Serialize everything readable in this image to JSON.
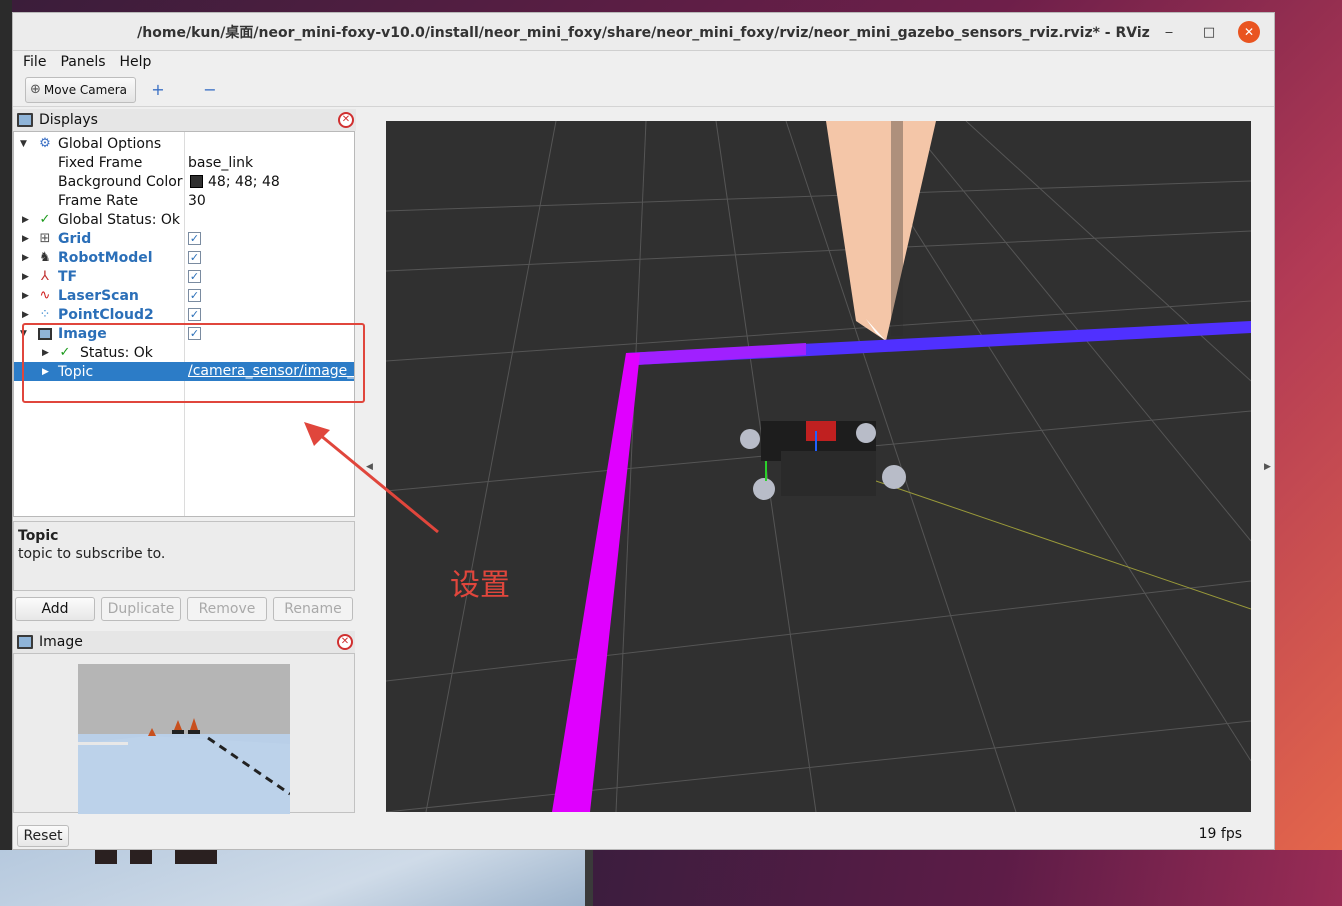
{
  "window": {
    "title": "/home/kun/桌面/neor_mini-foxy-v10.0/install/neor_mini_foxy/share/neor_mini_foxy/rviz/neor_mini_gazebo_sensors_rviz.rviz* - RViz",
    "minimize": "‒",
    "maximize": "□",
    "close": "✕"
  },
  "menu": {
    "file": "File",
    "panels": "Panels",
    "help": "Help"
  },
  "toolbar": {
    "move_camera": "Move Camera",
    "add": "+",
    "remove": "−"
  },
  "displays": {
    "title": "Displays",
    "rows": {
      "global_options": "Global Options",
      "fixed_frame_label": "Fixed Frame",
      "fixed_frame_value": "base_link",
      "bg_color_label": "Background Color",
      "bg_color_value": "48; 48; 48",
      "frame_rate_label": "Frame Rate",
      "frame_rate_value": "30",
      "global_status": "Global Status: Ok",
      "grid": "Grid",
      "robot_model": "RobotModel",
      "tf": "TF",
      "laser_scan": "LaserScan",
      "point_cloud": "PointCloud2",
      "image": "Image",
      "status_ok": "Status: Ok",
      "topic_label": "Topic",
      "topic_value": "/camera_sensor/image_raw"
    },
    "checkmark": "✓"
  },
  "description": {
    "heading": "Topic",
    "text": "topic to subscribe to."
  },
  "buttons": {
    "add": "Add",
    "duplicate": "Duplicate",
    "remove": "Remove",
    "rename": "Rename"
  },
  "image_panel": {
    "title": "Image"
  },
  "reset": "Reset",
  "fps": "19 fps",
  "annotation": "设置",
  "colors": {
    "accent_blue": "#2c7cc7",
    "annotation_red": "#e0463c",
    "viewport_bg": "#303030",
    "path_purple": "#e000ff",
    "laser_blue": "#1a40ff"
  }
}
